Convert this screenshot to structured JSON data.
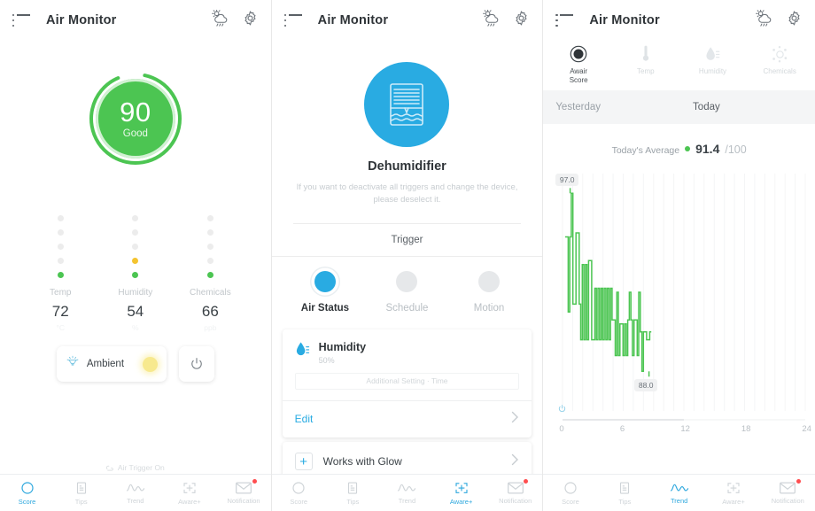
{
  "app": {
    "title": "Air Monitor"
  },
  "icons": {
    "menu": "list-menu-icon",
    "weather": "partly-cloudy-rain-icon",
    "settings": "gear-icon"
  },
  "panel1": {
    "gauge": {
      "score": "90",
      "label": "Good",
      "color": "#4CC552",
      "percent": 90
    },
    "sensors": [
      {
        "name": "Temp",
        "value": "72",
        "unit": "°C",
        "level": 1,
        "status_color": "#4CC552"
      },
      {
        "name": "Humidity",
        "value": "54",
        "unit": "%",
        "level": 2,
        "status_color": "#F4C430"
      },
      {
        "name": "Chemicals",
        "value": "66",
        "unit": "ppb",
        "level": 1,
        "status_color": "#4CC552"
      }
    ],
    "ambient": {
      "label": "Ambient",
      "icon": "lamp-icon",
      "glow_color": "#F7E98E"
    },
    "power": {
      "icon": "power-icon"
    },
    "footer": {
      "label": "Air Trigger On",
      "icon": "air-trigger-icon"
    }
  },
  "panel2": {
    "device": {
      "name": "Dehumidifier",
      "icon": "dehumidifier-icon",
      "circle_color": "#29ABE2",
      "description": "If you want to deactivate all triggers and change the device, please deselect it."
    },
    "trigger_title": "Trigger",
    "trigger_options": [
      {
        "label": "Air Status",
        "selected": true
      },
      {
        "label": "Schedule",
        "selected": false
      },
      {
        "label": "Motion",
        "selected": false
      }
    ],
    "humidity_card": {
      "icon": "humidity-drop-icon",
      "title": "Humidity",
      "subtitle": "50%",
      "additional_setting": "Additional Setting · Time",
      "edit_label": "Edit",
      "chevron": "chevron-right-icon"
    },
    "glow_card": {
      "label": "Works with Glow",
      "plus": "plus-icon",
      "chevron": "chevron-right-icon"
    }
  },
  "panel3": {
    "metric_tabs": [
      {
        "label": "Awair\nScore",
        "icon": "awair-score-icon",
        "active": true
      },
      {
        "label": "Temp",
        "icon": "thermometer-icon",
        "active": false
      },
      {
        "label": "Humidity",
        "icon": "humidity-drop-icon",
        "active": false
      },
      {
        "label": "Chemicals",
        "icon": "chemicals-icon",
        "active": false
      }
    ],
    "days": {
      "yesterday": "Yesterday",
      "today": "Today"
    },
    "average": {
      "label": "Today's Average",
      "value": "91.4",
      "denominator": "/100",
      "dot_color": "#4CC552"
    },
    "max_pill": "97.0",
    "min_pill": "88.0",
    "power_icon": "power-icon"
  },
  "chart_data": {
    "type": "line",
    "title": "Today's Average",
    "xlabel": "",
    "ylabel": "",
    "x_ticks": [
      "0",
      "6",
      "12",
      "18",
      "24"
    ],
    "xlim": [
      0,
      24
    ],
    "ylim": [
      86,
      98
    ],
    "line_color": "#4CC552",
    "grid": true,
    "annotations": [
      {
        "text": "97.0",
        "x": 0.75,
        "y": 97.0
      },
      {
        "text": "88.0",
        "x": 8.55,
        "y": 88.0
      }
    ],
    "values": [
      94.8,
      94.8,
      94.8,
      91.0,
      94.8,
      97.0,
      91.4,
      91.4,
      95.0,
      95.0,
      91.4,
      89.6,
      93.4,
      89.6,
      93.4,
      89.6,
      93.6,
      93.6,
      89.6,
      89.6,
      92.2,
      89.6,
      92.2,
      89.6,
      92.2,
      89.6,
      92.2,
      89.6,
      92.2,
      89.6,
      92.2,
      90.6,
      90.6,
      88.8,
      92.0,
      88.8,
      90.4,
      90.4,
      88.8,
      90.4,
      88.8,
      90.6,
      92.0,
      90.6,
      88.8,
      90.6,
      90.6,
      88.8,
      92.0,
      90.0,
      88.0,
      90.0,
      90.0,
      89.6,
      89.6,
      90.0
    ],
    "x_start": 0.25,
    "x_step": 0.155
  },
  "nav": {
    "items": [
      {
        "label": "Score",
        "icon": "score-ring-icon"
      },
      {
        "label": "Tips",
        "icon": "tips-doc-icon"
      },
      {
        "label": "Trend",
        "icon": "trend-wave-icon"
      },
      {
        "label": "Aware+",
        "icon": "aware-plus-icon"
      },
      {
        "label": "Notification",
        "icon": "envelope-icon",
        "badge": true
      }
    ],
    "active": {
      "panel1": "Score",
      "panel2": "Aware+",
      "panel3": "Trend"
    },
    "active_color": "#2FA8DE",
    "inactive_color": "#CFD4D8"
  }
}
